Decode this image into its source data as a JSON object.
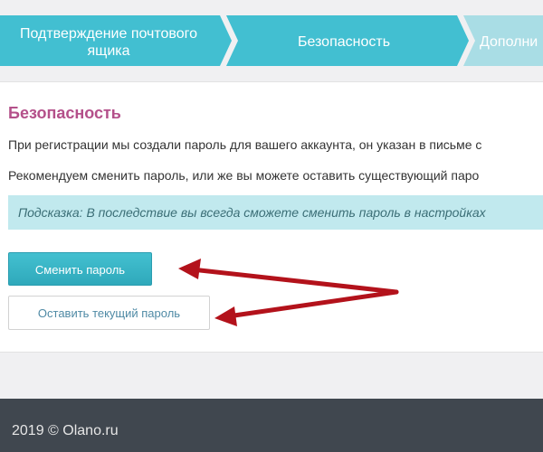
{
  "wizard": {
    "steps": [
      {
        "label": "Подтверждение почтового ящика"
      },
      {
        "label": "Безопасность"
      },
      {
        "label": "Дополни"
      }
    ]
  },
  "security": {
    "title": "Безопасность",
    "paragraph_1": "При регистрации мы создали пароль для вашего аккаунта, он указан в письме с",
    "paragraph_2": "Рекомендуем сменить пароль, или же вы можете оставить существующий паро",
    "hint": "Подсказка: В последствие вы всегда сможете сменить пароль в настройках",
    "change_button": "Сменить пароль",
    "keep_button": "Оставить текущий пароль"
  },
  "footer": {
    "text": "2019 © Olano.ru"
  },
  "colors": {
    "step_active": "#42bfd1",
    "step_next": "#a9dde5",
    "title": "#b4508a",
    "hint_bg": "#c1e9ee",
    "arrow": "#b3121b",
    "footer_bg": "#40474f"
  }
}
